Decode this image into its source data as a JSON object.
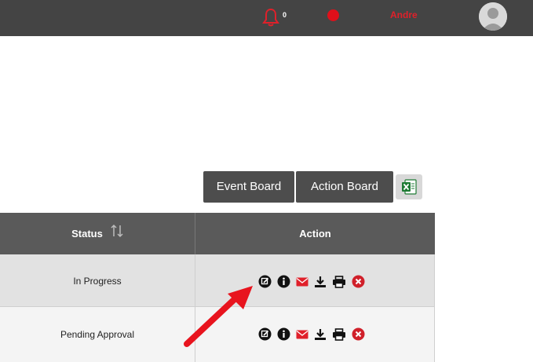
{
  "topbar": {
    "notification_count": "0",
    "username": "Andre",
    "status_color": "#e0101a",
    "accent_color": "#e0202a",
    "icons": [
      "bell-icon",
      "status-dot",
      "avatar"
    ]
  },
  "toolbar": {
    "event_board_label": "Event Board",
    "action_board_label": "Action Board",
    "export_icon": "excel-icon"
  },
  "table": {
    "columns": [
      "Status",
      "Action"
    ],
    "rows": [
      {
        "status": "In Progress"
      },
      {
        "status": "Pending Approval"
      }
    ],
    "action_icons": [
      "edit-icon",
      "info-icon",
      "email-icon",
      "download-icon",
      "print-icon",
      "delete-icon"
    ]
  }
}
